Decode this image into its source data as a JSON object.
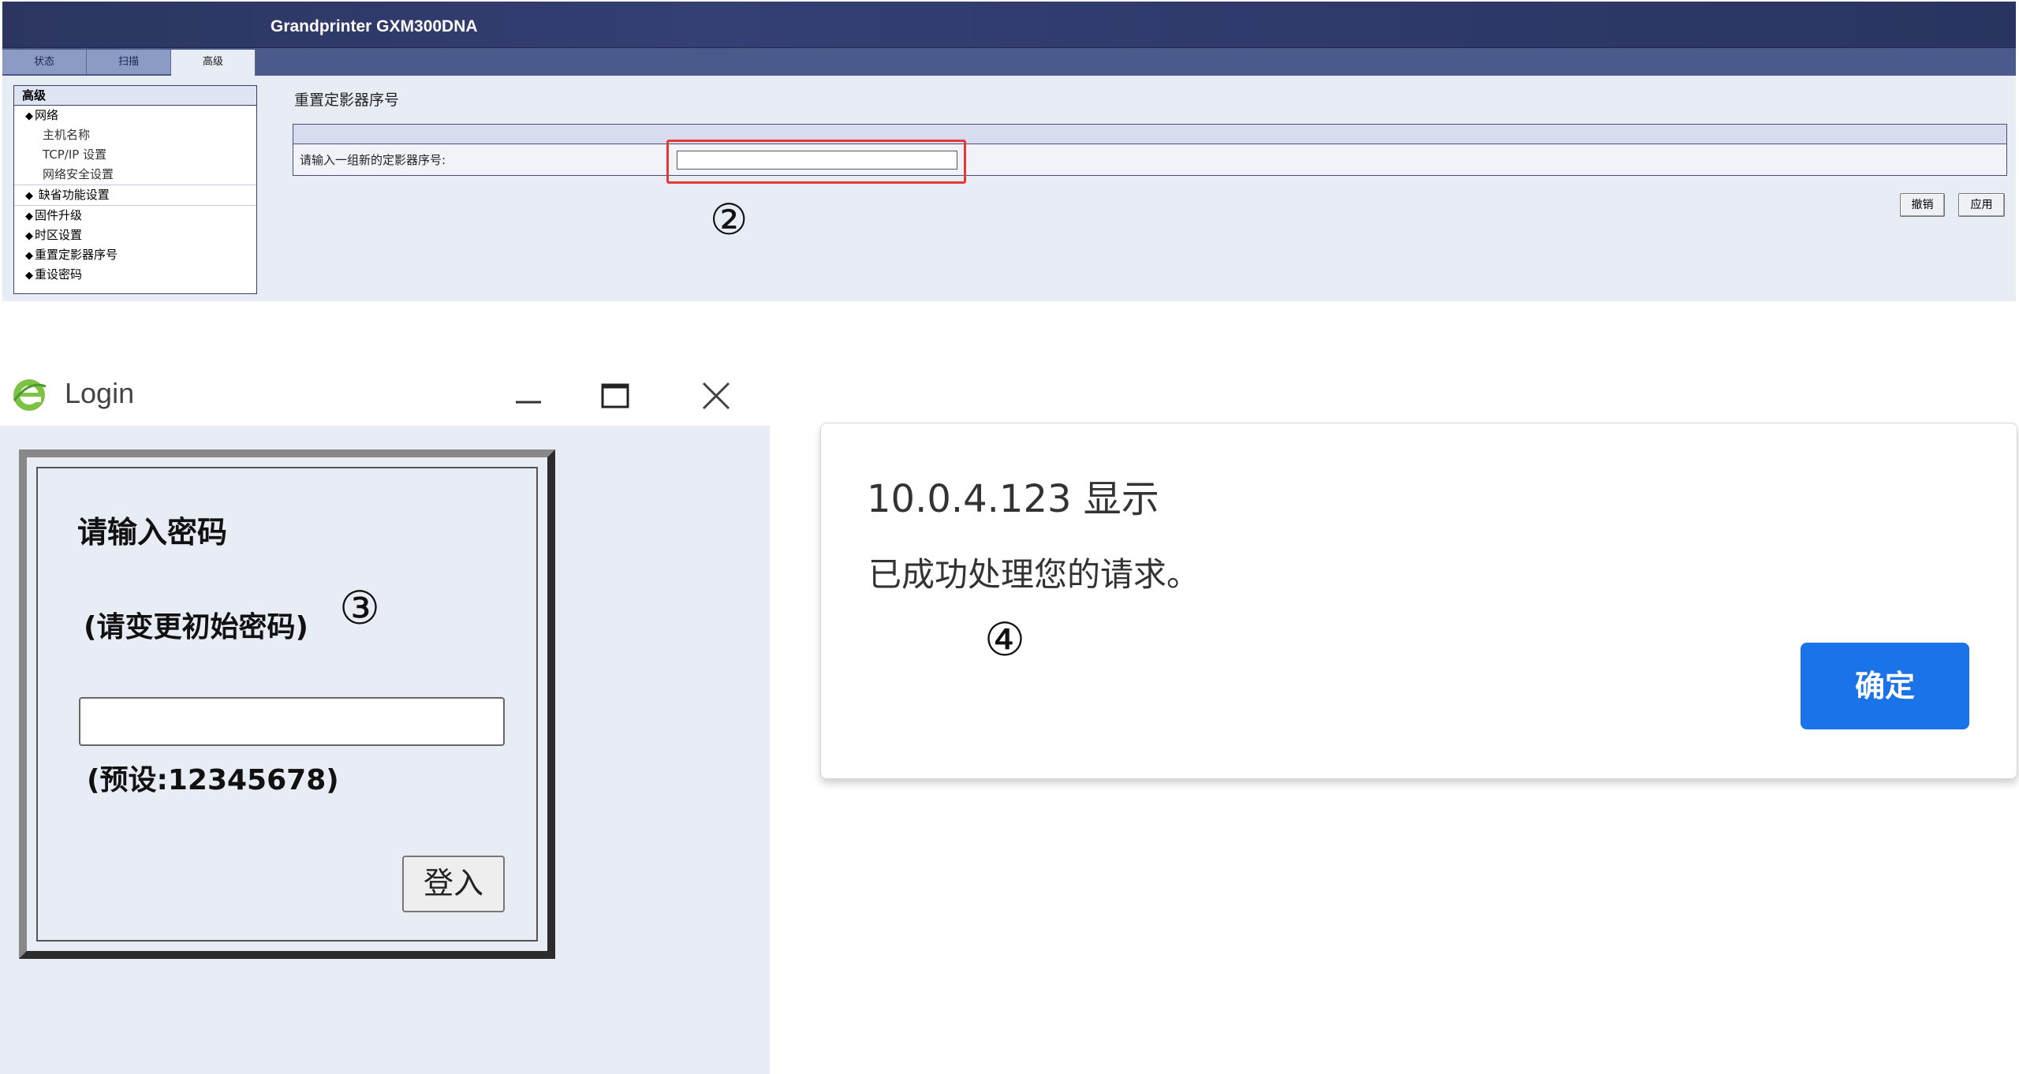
{
  "printer_ui": {
    "product_title": "Grandprinter GXM300DNA",
    "tabs": [
      {
        "label": "状态"
      },
      {
        "label": "扫描"
      },
      {
        "label": "高级"
      }
    ],
    "sidebar": {
      "header": "高级",
      "items": [
        {
          "label": "网络"
        },
        {
          "label": "主机名称"
        },
        {
          "label": "TCP/IP 设置"
        },
        {
          "label": "网络安全设置"
        },
        {
          "label": "缺省功能设置"
        },
        {
          "label": "固件升级"
        },
        {
          "label": "时区设置"
        },
        {
          "label": "重置定影器序号"
        },
        {
          "label": "重设密码"
        }
      ],
      "bullet": "◆"
    },
    "section_title": "重置定影器序号",
    "serial_label": "请输入一组新的定影器序号:",
    "serial_value": "",
    "cancel_label": "撤销",
    "apply_label": "应用",
    "marker": "②",
    "highlight_color": "#e53935"
  },
  "login": {
    "window_title": "Login",
    "prompt_title": "请输入密码",
    "prompt_note": "(请变更初始密码)",
    "password_value": "",
    "default_note": "(预设:12345678)",
    "login_label": "登入",
    "marker": "③"
  },
  "alert": {
    "origin": "10.0.4.123 显示",
    "message": "已成功处理您的请求。",
    "ok_label": "确定",
    "ok_color": "#1a73e8",
    "marker": "④"
  }
}
